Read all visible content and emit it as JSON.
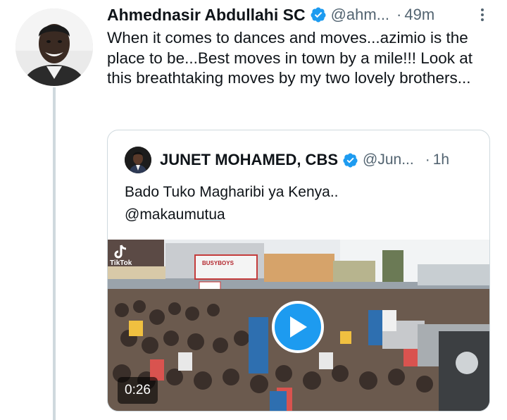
{
  "tweet": {
    "author_name": "Ahmednasir Abdullahi SC",
    "author_handle": "@ahm...",
    "separator": "·",
    "time": "49m",
    "text": "When it comes to dances and moves...azimio is the place to be...Best moves in town by a mile!!! Look at this breathtaking moves by my two lovely brothers..."
  },
  "quote": {
    "author_name": "JUNET MOHAMED, CBS",
    "author_handle": "@Jun...",
    "separator": "·",
    "time": "1h",
    "text_line1": "Bado Tuko Magharibi ya Kenya..",
    "text_line2": "@makaumutua",
    "media": {
      "watermark": "TikTok",
      "duration": "0:26",
      "signs": [
        "BUSYBOYS"
      ]
    }
  },
  "colors": {
    "accent": "#1d9bf0",
    "text_primary": "#0f1419",
    "text_secondary": "#536471",
    "border": "#cfd9de"
  },
  "icons": {
    "verified": "verified-badge-icon",
    "more": "more-options-icon",
    "play": "play-icon"
  }
}
